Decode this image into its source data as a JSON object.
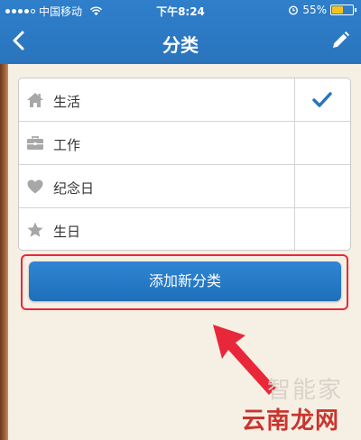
{
  "status_bar": {
    "carrier": "中国移动",
    "time": "下午8:24",
    "battery_percent": "55%",
    "battery_level": 0.55
  },
  "nav": {
    "title": "分类"
  },
  "categories": [
    {
      "label": "生活",
      "icon": "home-icon",
      "selected": true
    },
    {
      "label": "工作",
      "icon": "briefcase-icon",
      "selected": false
    },
    {
      "label": "纪念日",
      "icon": "heart-icon",
      "selected": false
    },
    {
      "label": "生日",
      "icon": "star-icon",
      "selected": false
    }
  ],
  "add_button": {
    "label": "添加新分类"
  },
  "watermark": {
    "line1": "智能家",
    "line2": "云南龙网"
  },
  "colors": {
    "nav_blue": "#2a74bd",
    "check_blue": "#2a74bd",
    "highlight_red": "#e8283a"
  }
}
